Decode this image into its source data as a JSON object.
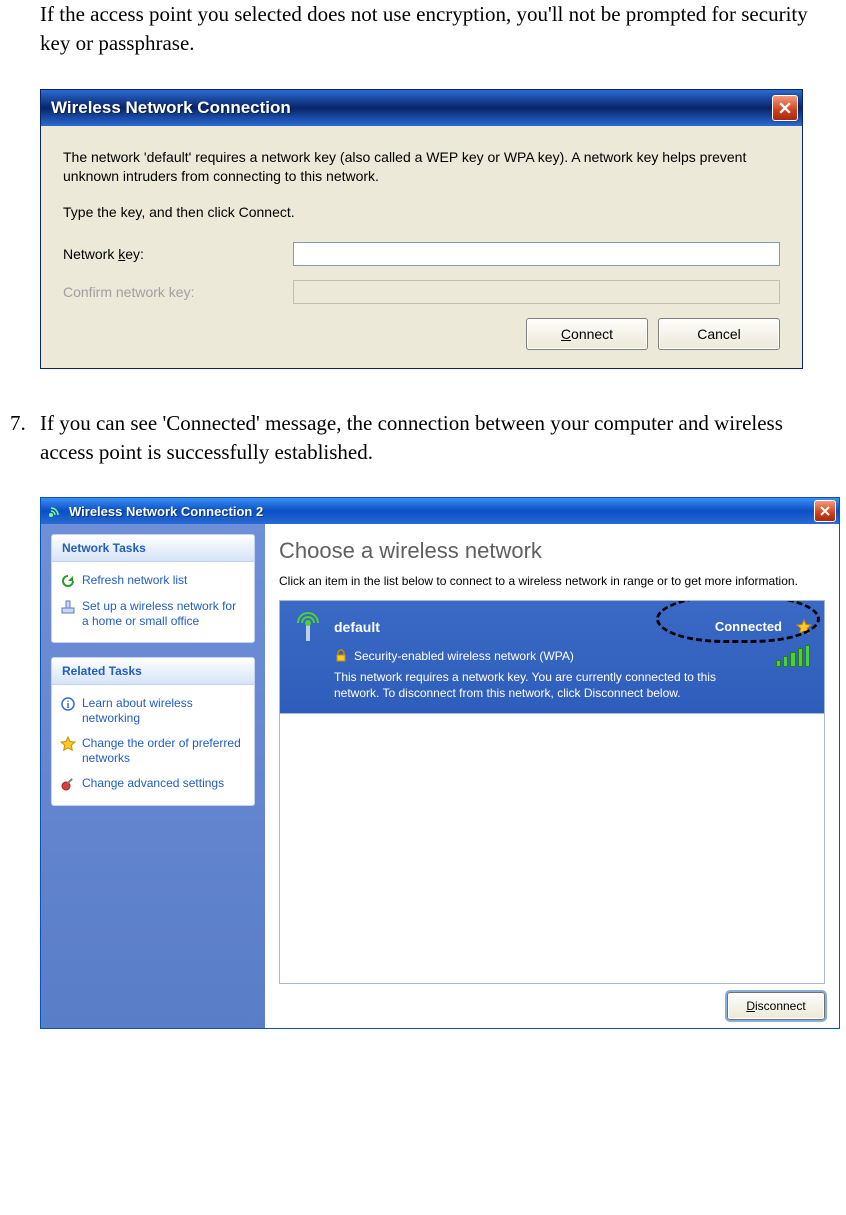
{
  "doc": {
    "para1": "If the access point you selected does not use encryption, you'll not be prompted for security key or passphrase.",
    "step_num": "7.",
    "para2": "If you can see 'Connected' message, the connection between your computer and wireless access point is successfully established."
  },
  "dlg1": {
    "title": "Wireless Network Connection",
    "desc": "The network 'default' requires a network key (also called a WEP key or WPA key). A network key helps prevent unknown intruders from connecting to this network.",
    "instr": "Type the key, and then click Connect.",
    "label_key_pre": "Network ",
    "label_key_u": "k",
    "label_key_post": "ey:",
    "label_confirm": "Confirm network key:",
    "value_key": "",
    "value_confirm": "",
    "btn_connect_u": "C",
    "btn_connect_rest": "onnect",
    "btn_cancel": "Cancel"
  },
  "dlg2": {
    "title": "Wireless Network Connection 2",
    "sidebar": {
      "panel1_hdr": "Network Tasks",
      "task_refresh": "Refresh network list",
      "task_setup": "Set up a wireless network for a home or small office",
      "panel2_hdr": "Related Tasks",
      "task_learn": "Learn about wireless networking",
      "task_order": "Change the order of preferred networks",
      "task_advanced": "Change advanced settings"
    },
    "main": {
      "heading": "Choose a wireless network",
      "sub": "Click an item in the list below to connect to a wireless network in range or to get more information.",
      "net": {
        "ssid": "default",
        "status": "Connected",
        "security": "Security-enabled wireless network (WPA)",
        "msg": "This network requires a network key. You are currently connected to this network. To disconnect from this network, click Disconnect below."
      },
      "btn_disconnect_u": "D",
      "btn_disconnect_rest": "isconnect"
    }
  }
}
